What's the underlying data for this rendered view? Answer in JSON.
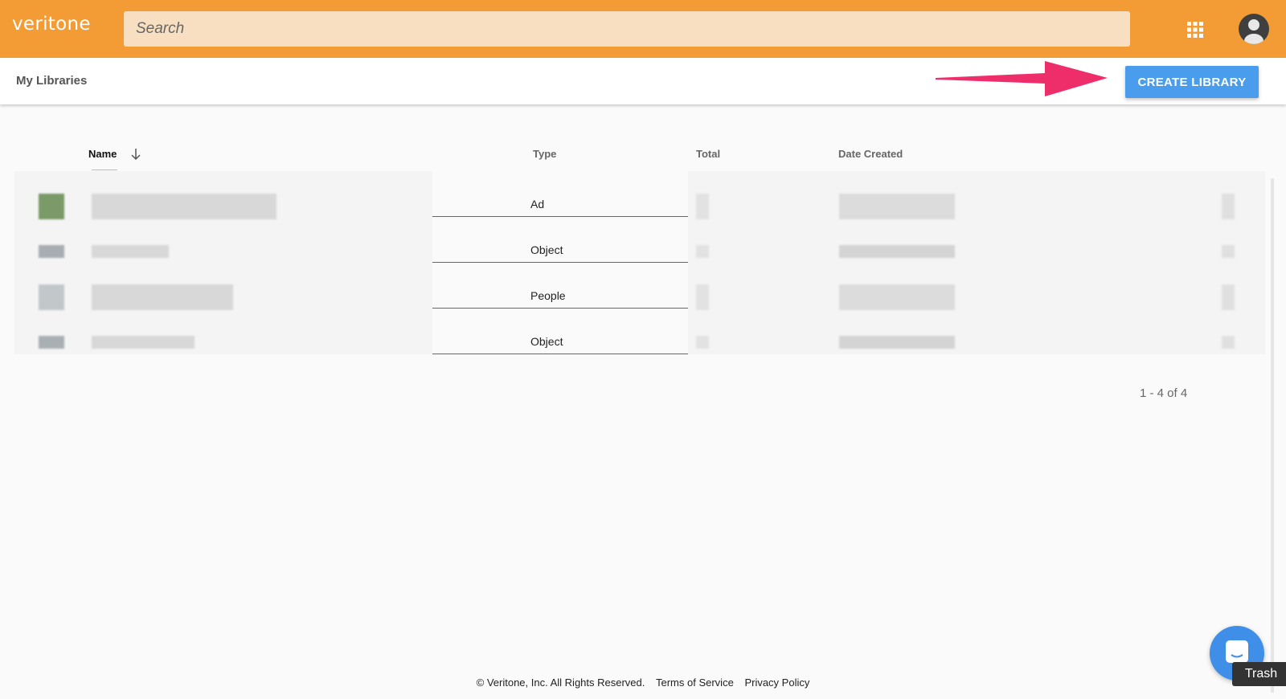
{
  "app": {
    "logo": "veritone"
  },
  "search": {
    "placeholder": "Search"
  },
  "toolbar": {
    "title": "My Libraries",
    "create_label": "CREATE LIBRARY"
  },
  "table": {
    "columns": [
      "Name",
      "Type",
      "Total",
      "Date Created"
    ],
    "rows": [
      {
        "type": "Ad"
      },
      {
        "type": "Object"
      },
      {
        "type": "People"
      },
      {
        "type": "Object"
      }
    ],
    "pagination": "1 - 4 of 4"
  },
  "footer": {
    "copyright": "© Veritone, Inc. All Rights Reserved.",
    "terms": "Terms of Service",
    "privacy": "Privacy Policy"
  },
  "tooltip": "Trash",
  "colors": {
    "appbar": "#f39c36",
    "accent": "#4a9cec",
    "arrow": "#ee2e6b"
  },
  "icons": [
    "apps-grid-icon",
    "account-icon",
    "sort-down-icon",
    "chat-icon"
  ]
}
